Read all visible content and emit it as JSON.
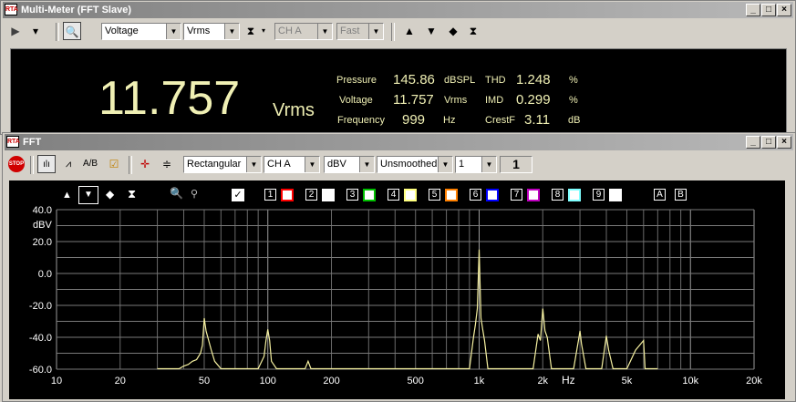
{
  "multimeter": {
    "title": "Multi-Meter (FFT Slave)",
    "toolbar": {
      "mode": "Voltage",
      "unit": "Vrms",
      "channel": "CH A",
      "speed": "Fast"
    },
    "main_value": "11.757",
    "main_unit": "Vrms",
    "readings": [
      {
        "label": "Pressure",
        "value": "145.86",
        "unit": "dBSPL"
      },
      {
        "label": "Voltage",
        "value": "11.757",
        "unit": "Vrms"
      },
      {
        "label": "Frequency",
        "value": "999",
        "unit": "Hz"
      }
    ],
    "distortion": [
      {
        "label": "THD",
        "value": "1.248",
        "unit": "%"
      },
      {
        "label": "IMD",
        "value": "0.299",
        "unit": "%"
      },
      {
        "label": "CrestF",
        "value": "3.11",
        "unit": "dB"
      }
    ]
  },
  "fft": {
    "title": "FFT",
    "toolbar": {
      "window": "Rectangular",
      "channel": "CH A",
      "unit": "dBV",
      "smoothing": "Unsmoothed",
      "averages": "1",
      "count": "1",
      "stop_label": "STOP"
    },
    "legend_numbers": [
      "1",
      "2",
      "3",
      "4",
      "5",
      "6",
      "7",
      "8",
      "9"
    ],
    "legend_colors": [
      "#ff0000",
      "#ffffff",
      "#00c000",
      "#ffff80",
      "#ff8000",
      "#0000ff",
      "#c000c0",
      "#80ffff",
      "#ffffff"
    ],
    "legend_letters": [
      "A",
      "B"
    ],
    "trace_color": "#f5f0a0"
  },
  "chart_data": {
    "type": "line",
    "ylabel": "dBV",
    "xlabel": "Hz",
    "xscale": "log",
    "xlim": [
      10,
      20000
    ],
    "ylim": [
      -60,
      40
    ],
    "yticks": [
      "40.0",
      "20.0",
      "0.0",
      "-20.0",
      "-40.0",
      "-60.0"
    ],
    "xticks": [
      "10",
      "20",
      "50",
      "100",
      "200",
      "500",
      "1k",
      "2k",
      "5k",
      "10k",
      "20k"
    ],
    "series": [
      {
        "x": [
          30,
          38,
          40,
          42,
          44,
          46,
          48,
          49,
          50,
          51,
          52,
          54,
          56,
          60,
          90,
          96,
          98,
          100,
          102,
          104,
          110,
          150,
          155,
          160,
          900,
          940,
          960,
          980,
          1000,
          1020,
          1040,
          1060,
          1100,
          1800,
          1900,
          1950,
          2000,
          2050,
          2100,
          2200,
          2800,
          2950,
          3000,
          3050,
          3200,
          3800,
          3950,
          4000,
          4100,
          4300,
          5000,
          5500,
          6000,
          6100,
          7000
        ],
        "y": [
          -60,
          -60,
          -58,
          -57,
          -55,
          -54,
          -50,
          -45,
          -28,
          -36,
          -40,
          -48,
          -55,
          -60,
          -60,
          -52,
          -42,
          -35,
          -42,
          -55,
          -60,
          -60,
          -55,
          -60,
          -60,
          -40,
          -32,
          -22,
          15,
          -28,
          -35,
          -42,
          -60,
          -60,
          -38,
          -42,
          -22,
          -36,
          -40,
          -60,
          -60,
          -42,
          -36,
          -44,
          -60,
          -60,
          -44,
          -39,
          -48,
          -60,
          -60,
          -48,
          -42,
          -60,
          -60
        ]
      }
    ]
  }
}
